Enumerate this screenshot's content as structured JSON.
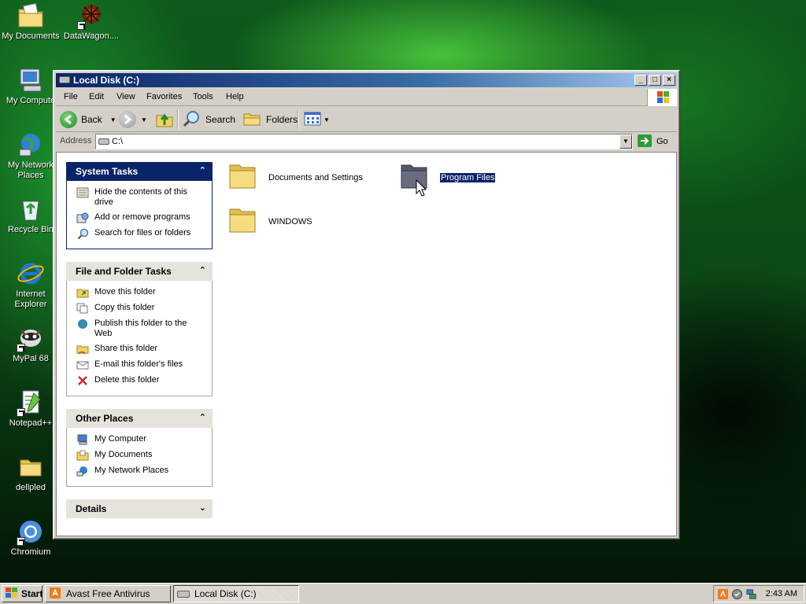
{
  "desktop": {
    "icons": [
      {
        "label": "My Documents"
      },
      {
        "label": "DataWagon...."
      },
      {
        "label": "My Compute"
      },
      {
        "label": "My Network Places"
      },
      {
        "label": "Recycle Bin"
      },
      {
        "label": "Internet Explorer"
      },
      {
        "label": "MyPal 68"
      },
      {
        "label": "Notepad++"
      },
      {
        "label": "dellpled"
      },
      {
        "label": "Chromium"
      }
    ]
  },
  "window": {
    "title": "Local Disk (C:)",
    "controls": {
      "minimize": "_",
      "maximize": "□",
      "close": "×"
    },
    "menu": [
      "File",
      "Edit",
      "View",
      "Favorites",
      "Tools",
      "Help"
    ],
    "toolbar": {
      "back": "Back",
      "search": "Search",
      "folders": "Folders"
    },
    "address": {
      "label": "Address",
      "value": "C:\\",
      "go": "Go"
    },
    "taskpane": {
      "system_tasks": {
        "title": "System Tasks",
        "items": [
          "Hide the contents of this drive",
          "Add or remove programs",
          "Search for files or folders"
        ]
      },
      "file_folder_tasks": {
        "title": "File and Folder Tasks",
        "items": [
          "Move this folder",
          "Copy this folder",
          "Publish this folder to the Web",
          "Share this folder",
          "E-mail this folder's files",
          "Delete this folder"
        ]
      },
      "other_places": {
        "title": "Other Places",
        "items": [
          "My Computer",
          "My Documents",
          "My Network Places"
        ]
      },
      "details": {
        "title": "Details"
      }
    },
    "folders": [
      {
        "name": "Documents and Settings",
        "selected": false
      },
      {
        "name": "Program Files",
        "selected": true
      },
      {
        "name": "WINDOWS",
        "selected": false
      }
    ]
  },
  "taskbar": {
    "start": "Start",
    "tasks": [
      {
        "label": "Avast Free Antivirus",
        "active": false
      },
      {
        "label": "Local Disk (C:)",
        "active": true
      }
    ],
    "clock": "2:43 AM"
  },
  "colors": {
    "title_active": "#0a246a",
    "selection": "#0a246a",
    "folder": "#f2d265",
    "folder_dark": "#6a6c7a"
  }
}
